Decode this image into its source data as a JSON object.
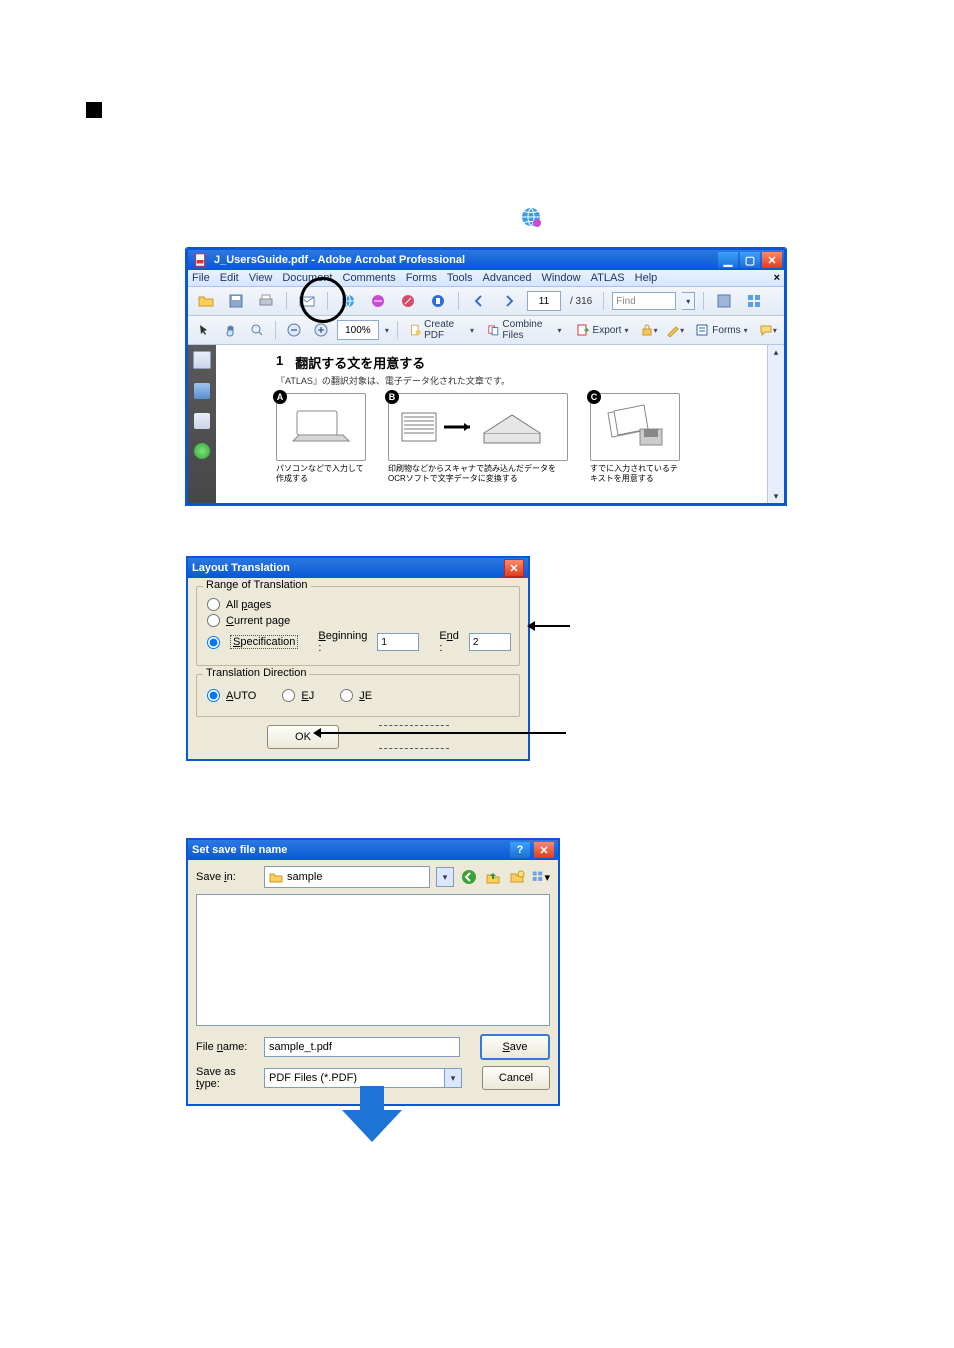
{
  "acrobat": {
    "title": "J_UsersGuide.pdf - Adobe Acrobat Professional",
    "menus": [
      "File",
      "Edit",
      "View",
      "Document",
      "Comments",
      "Forms",
      "Tools",
      "Advanced",
      "Window",
      "ATLAS",
      "Help"
    ],
    "page_current": "11",
    "page_total": "/ 316",
    "find_placeholder": "Find",
    "zoom": "100%",
    "tool_labels": {
      "create": "Create PDF",
      "combine": "Combine Files",
      "export": "Export",
      "forms": "Forms"
    },
    "doc": {
      "num": "1",
      "heading": "翻訳する文を用意する",
      "sub": "『ATLAS』の翻訳対象は、電子データ化された文章です。",
      "cards": {
        "a": "パソコンなどで入力して作成する",
        "b": "印刷物などからスキャナで読み込んだデータをOCRソフトで文字データに変換する",
        "c": "すでに入力されているテキストを用意する"
      }
    }
  },
  "layout_dlg": {
    "title": "Layout Translation",
    "range_legend": "Range of Translation",
    "opts": {
      "all": "All pages",
      "current": "Current page",
      "spec": "Specification"
    },
    "beg_label": "Beginning :",
    "beg_val": "1",
    "end_label": "End :",
    "end_val": "2",
    "dir_legend": "Translation Direction",
    "dirs": {
      "auto": "AUTO",
      "ej": "EJ",
      "je": "JE"
    },
    "ok": "OK"
  },
  "save_dlg": {
    "title": "Set save file name",
    "savein_label": "Save in:",
    "savein_value": "sample",
    "filename_label": "File name:",
    "filename_value": "sample_t.pdf",
    "type_label": "Save as type:",
    "type_value": "PDF Files (*.PDF)",
    "save_btn": "Save",
    "cancel_btn": "Cancel"
  }
}
